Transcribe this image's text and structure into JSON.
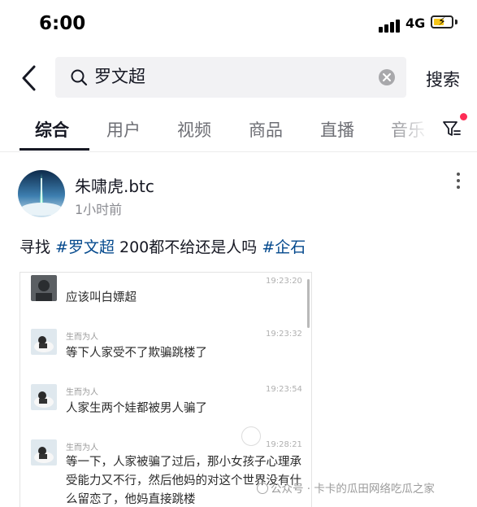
{
  "status_bar": {
    "time": "6:00",
    "network": "4G",
    "battery_level": 0.6,
    "battery_color": "#f5c518"
  },
  "search": {
    "query": "罗文超",
    "submit_label": "搜索"
  },
  "tabs": [
    {
      "label": "综合",
      "active": true
    },
    {
      "label": "用户",
      "active": false
    },
    {
      "label": "视频",
      "active": false
    },
    {
      "label": "商品",
      "active": false
    },
    {
      "label": "直播",
      "active": false
    },
    {
      "label": "音乐",
      "active": false
    }
  ],
  "post": {
    "author": "朱啸虎.btc",
    "time": "1小时前",
    "text_prefix": "寻找 ",
    "hashtag_1": "#罗文超",
    "text_middle": " 200都不给还是人吗 ",
    "hashtag_2": "#企石"
  },
  "chat": {
    "messages": [
      {
        "sender": "",
        "time": "19:23:20",
        "text": "应该叫白嫖超"
      },
      {
        "sender": "生而为人",
        "time": "19:23:32",
        "text": "等下人家受不了欺骗跳楼了"
      },
      {
        "sender": "生而为人",
        "time": "19:23:54",
        "text": "人家生两个娃都被男人骗了"
      },
      {
        "sender": "生而为人",
        "time": "19:28:21",
        "text": "等一下，人家被骗了过后，那小女孩子心理承受能力又不行，然后他妈的对这个世界没有什么留恋了，他妈直接跳楼"
      }
    ]
  },
  "watermark": "公众号 · 卡卡的瓜田网络吃瓜之家",
  "colors": {
    "hashtag": "#04498d",
    "notification_dot": "#fe2c55",
    "active_tab": "#161823",
    "inactive_tab": "#6e6f75"
  },
  "icons": [
    "back-arrow-icon",
    "search-icon",
    "clear-icon",
    "filter-icon",
    "more-vertical-icon"
  ]
}
